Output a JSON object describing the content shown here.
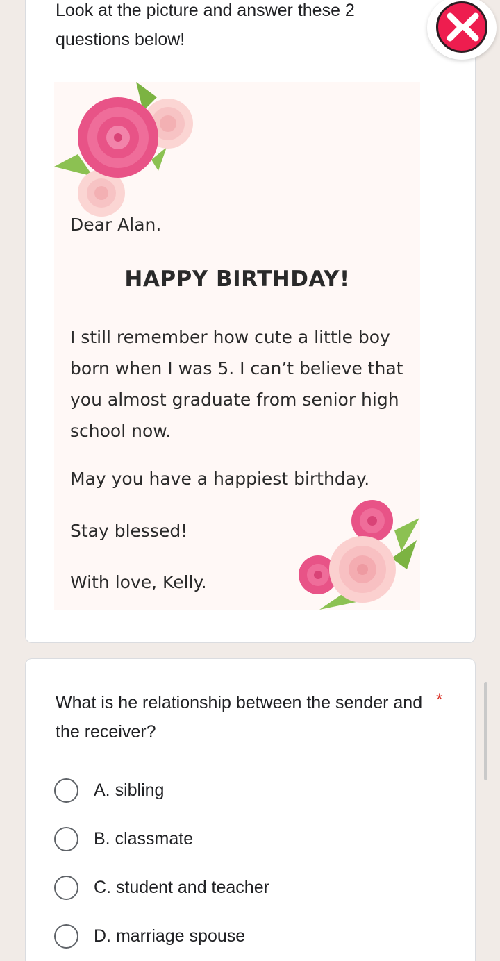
{
  "instruction": "Look at the picture and answer these 2 questions below!",
  "greeting_card": {
    "salutation": "Dear Alan.",
    "headline": "HAPPY BIRTHDAY!",
    "message": "I still remember how cute a little boy born when I was 5. I can’t believe that you almost graduate from senior high school now.",
    "wish": "May you have a happiest birthday.",
    "closing": "Stay blessed!",
    "signature": "With love, Kelly."
  },
  "question": {
    "text": "What is he relationship between the sender and the receiver?",
    "required_mark": "*",
    "options": [
      {
        "label": "A. sibling"
      },
      {
        "label": "B. classmate"
      },
      {
        "label": "C. student and teacher"
      },
      {
        "label": "D. marriage spouse"
      }
    ]
  },
  "floating_button": {
    "icon": "double-arrow-logo-icon",
    "color": "#ee1d4f"
  },
  "colors": {
    "page_background": "#f1ebe7",
    "required": "#d93025",
    "rose_dark": "#e85387",
    "rose_light": "#f9c8cc",
    "leaf": "#8cc152"
  }
}
